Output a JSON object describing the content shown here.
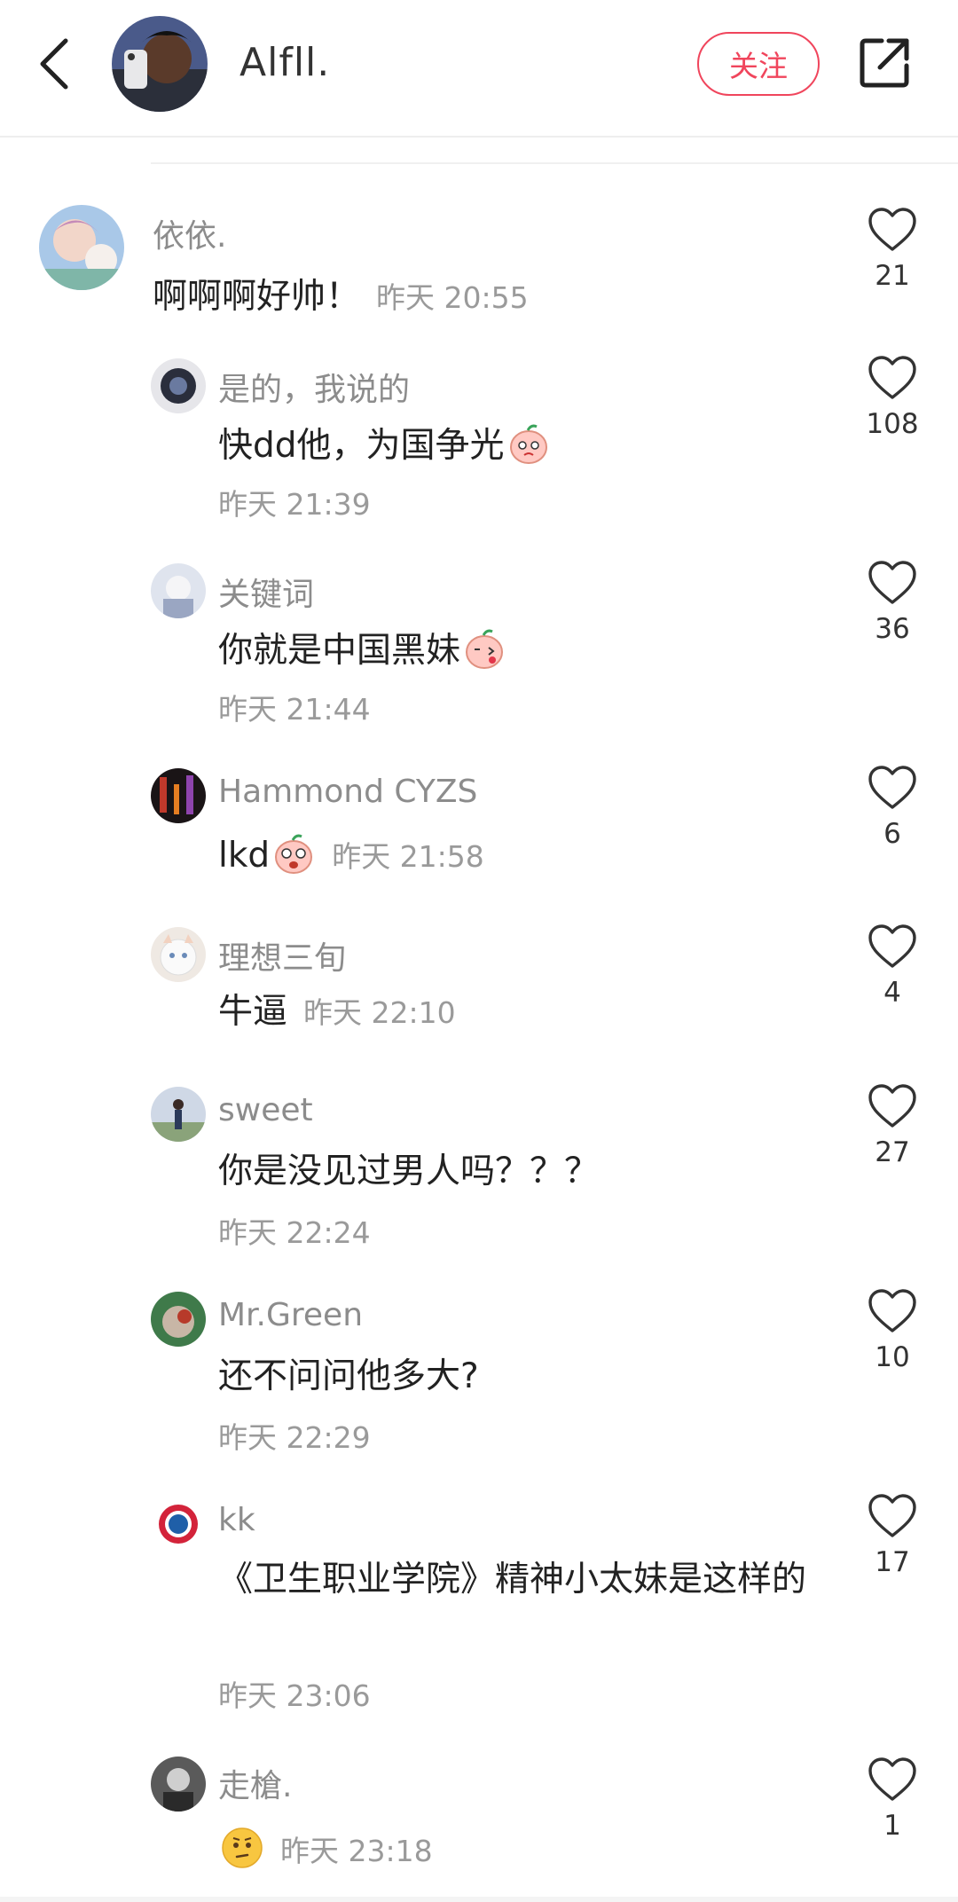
{
  "header": {
    "author_name": "Alfll.",
    "follow_label": "关注"
  },
  "comments": [
    {
      "user": "依依.",
      "text": "啊啊啊好帅！",
      "time": "昨天 20:55",
      "likes": "21"
    },
    {
      "user": "是的，我说的",
      "text": "快dd他，为国争光",
      "time": "昨天 21:39",
      "likes": "108"
    },
    {
      "user": "关键词",
      "text": "你就是中国黑妹",
      "time": "昨天 21:44",
      "likes": "36"
    },
    {
      "user": "Hammond CYZS",
      "text": "lkd",
      "time": "昨天 21:58",
      "likes": "6"
    },
    {
      "user": "理想三旬",
      "text": "牛逼",
      "time": "昨天 22:10",
      "likes": "4"
    },
    {
      "user": "sweet",
      "text": "你是没见过男人吗？？？",
      "time": "昨天 22:24",
      "likes": "27"
    },
    {
      "user": "Mr.Green",
      "text": "还不问问他多大?",
      "time": "昨天 22:29",
      "likes": "10"
    },
    {
      "user": "kk",
      "text": "《卫生职业学院》精神小太妹是这样的",
      "time": "昨天 23:06",
      "likes": "17"
    },
    {
      "user": "走槍.",
      "text": "",
      "time": "昨天 23:18",
      "likes": "1"
    }
  ],
  "icons": {
    "back": "chevron-left-icon",
    "share": "share-icon",
    "like": "heart-outline-icon"
  },
  "colors": {
    "accent": "#f0455c",
    "username": "#8c8c8c",
    "timestamp": "#9a9a9a"
  }
}
